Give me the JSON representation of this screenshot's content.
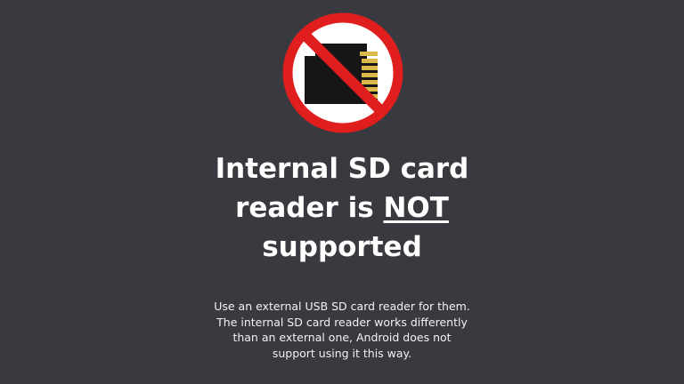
{
  "screen": {
    "icon": "no-sd-card-icon",
    "colors": {
      "background": "#393a40",
      "prohibition_red": "#e01e1e",
      "card_body": "#161616",
      "card_contacts": "#d8b94a",
      "text": "#ffffff"
    },
    "headline": {
      "line1": "Internal SD card",
      "line2_prefix": "reader is ",
      "line2_emphasis": "NOT",
      "line3": "supported"
    },
    "message": {
      "line1": "Use an external USB SD card reader for them.",
      "line2": "The internal SD card reader works differently",
      "line3": "than an external one, Android does not",
      "line4": "support using it this way."
    }
  }
}
